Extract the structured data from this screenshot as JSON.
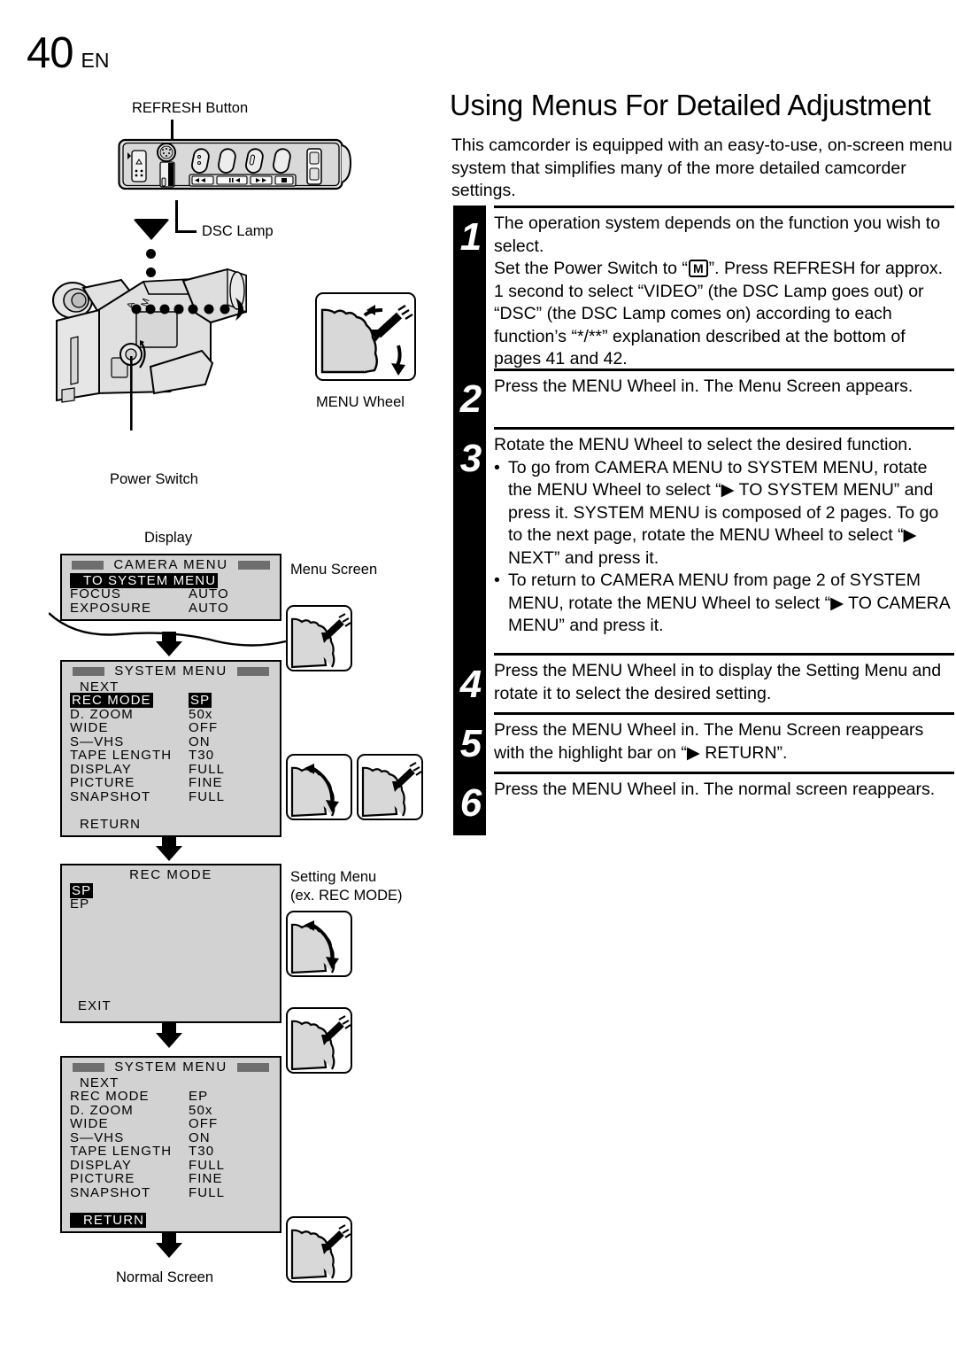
{
  "page": {
    "number": "40",
    "locale": "EN"
  },
  "illustration": {
    "refresh_button_label": "REFRESH Button",
    "dsc_lamp_label": "DSC Lamp",
    "menu_wheel_label": "MENU Wheel",
    "power_switch_label": "Power Switch",
    "display_label": "Display",
    "menu_screen_label": "Menu Screen",
    "setting_menu_label_line1": "Setting Menu",
    "setting_menu_label_line2": "(ex. REC MODE)",
    "normal_screen_label": "Normal Screen",
    "transport_buttons": [
      "◀◀",
      "❙❙/◀",
      "▶▶",
      "■"
    ]
  },
  "osd_screens": [
    {
      "name": "camera-menu",
      "title": "CAMERA  MENU",
      "rows": [
        {
          "key": "TO  SYSTEM  MENU",
          "value": "",
          "highlight": true,
          "marker": true
        },
        {
          "key": "FOCUS",
          "value": "AUTO",
          "highlight": false
        },
        {
          "key": "EXPOSURE",
          "value": "AUTO",
          "highlight": false
        }
      ]
    },
    {
      "name": "system-menu-page1",
      "title": "SYSTEM  MENU",
      "rows": [
        {
          "key": "NEXT",
          "value": "",
          "highlight": false,
          "indent": true
        },
        {
          "key": "REC  MODE",
          "value": "SP",
          "highlight": true,
          "value_highlight": true
        },
        {
          "key": "D.  ZOOM",
          "value": "50x",
          "highlight": false
        },
        {
          "key": "WIDE",
          "value": "OFF",
          "highlight": false
        },
        {
          "key": "S—VHS",
          "value": "ON",
          "highlight": false
        },
        {
          "key": "TAPE  LENGTH",
          "value": "T30",
          "highlight": false
        },
        {
          "key": "DISPLAY",
          "value": "FULL",
          "highlight": false
        },
        {
          "key": "PICTURE",
          "value": "FINE",
          "highlight": false
        },
        {
          "key": "SNAPSHOT",
          "value": "FULL",
          "highlight": false
        },
        {
          "key": "",
          "value": "",
          "highlight": false
        },
        {
          "key": "RETURN",
          "value": "",
          "highlight": false,
          "indent": true
        }
      ]
    },
    {
      "name": "rec-mode-setting-menu",
      "title": "REC  MODE",
      "plain_title": true,
      "rows": [
        {
          "key": "SP",
          "value": "",
          "highlight": true
        },
        {
          "key": "EP",
          "value": "",
          "highlight": false
        }
      ],
      "footer": "EXIT"
    },
    {
      "name": "system-menu-after",
      "title": "SYSTEM  MENU",
      "rows": [
        {
          "key": "NEXT",
          "value": "",
          "highlight": false,
          "indent": true
        },
        {
          "key": "REC  MODE",
          "value": "EP",
          "highlight": false
        },
        {
          "key": "D.  ZOOM",
          "value": "50x",
          "highlight": false
        },
        {
          "key": "WIDE",
          "value": "OFF",
          "highlight": false
        },
        {
          "key": "S—VHS",
          "value": "ON",
          "highlight": false
        },
        {
          "key": "TAPE  LENGTH",
          "value": "T30",
          "highlight": false
        },
        {
          "key": "DISPLAY",
          "value": "FULL",
          "highlight": false
        },
        {
          "key": "PICTURE",
          "value": "FINE",
          "highlight": false
        },
        {
          "key": "SNAPSHOT",
          "value": "FULL",
          "highlight": false
        },
        {
          "key": "",
          "value": "",
          "highlight": false
        },
        {
          "key": "RETURN",
          "value": "",
          "highlight": true,
          "marker": true
        }
      ]
    }
  ],
  "article": {
    "title": "Using Menus For Detailed Adjustment",
    "intro": "This camcorder is equipped with an easy-to-use, on-screen menu system that simplifies many of the more detailed camcorder settings.",
    "steps": [
      {
        "number": "1",
        "lines": [
          "The operation system depends on the function you wish to select.",
          "Set the Power Switch to “□M”. Press REFRESH for approx. 1 second to select “VIDEO” (the DSC Lamp goes out) or “DSC” (the DSC Lamp comes on) according to each function’s “*/**” explanation described at the bottom of pages 41 and 42."
        ]
      },
      {
        "number": "2",
        "lines": [
          "Press the MENU Wheel in. The Menu Screen appears."
        ]
      },
      {
        "number": "3",
        "lines": [
          "Rotate the MENU Wheel to select the desired function."
        ],
        "bullets": [
          "To go from CAMERA MENU to SYSTEM MENU, rotate the MENU Wheel to select “▶ TO SYSTEM MENU” and press it. SYSTEM MENU is composed of 2 pages. To go to the next page, rotate the MENU Wheel to select “▶ NEXT” and press it.",
          "To return to CAMERA MENU from page 2 of SYSTEM MENU, rotate the MENU Wheel to select “▶ TO CAMERA MENU” and press it."
        ]
      },
      {
        "number": "4",
        "lines": [
          "Press the MENU Wheel in to display the Setting Menu and rotate it to select the desired setting."
        ]
      },
      {
        "number": "5",
        "lines": [
          "Press the MENU Wheel in. The Menu Screen reappears with the highlight bar on “▶ RETURN”."
        ]
      },
      {
        "number": "6",
        "lines": [
          "Press the MENU Wheel in. The normal screen reappears."
        ]
      }
    ]
  },
  "colors": {
    "osd_background": "#d2d2d2",
    "osd_title_bar": "#6e6e6e",
    "ink": "#000000",
    "paper": "#ffffff"
  }
}
